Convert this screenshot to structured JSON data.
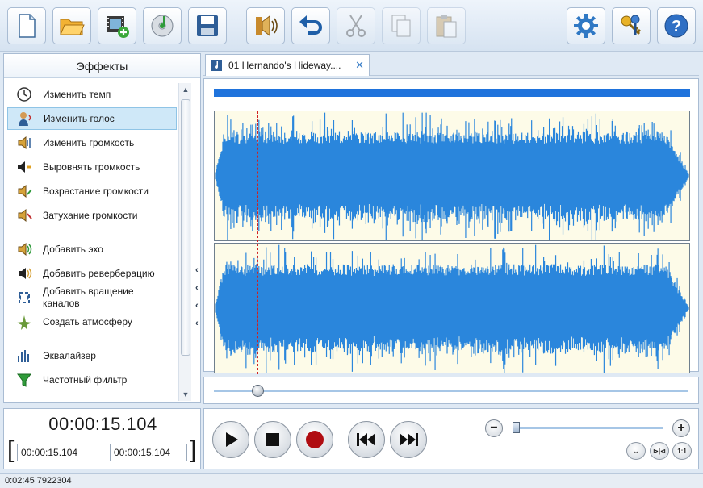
{
  "toolbar": {
    "buttons": [
      {
        "icon": "new-file-icon",
        "enabled": true
      },
      {
        "icon": "open-folder-icon",
        "enabled": true
      },
      {
        "icon": "import-video-icon",
        "enabled": true
      },
      {
        "icon": "cd-music-icon",
        "enabled": true
      },
      {
        "icon": "save-disk-icon",
        "enabled": true
      },
      {
        "icon": "audio-speaker-icon",
        "enabled": true
      },
      {
        "icon": "undo-icon",
        "enabled": true
      },
      {
        "icon": "cut-icon",
        "enabled": false
      },
      {
        "icon": "copy-icon",
        "enabled": false
      },
      {
        "icon": "paste-icon",
        "enabled": false
      },
      {
        "icon": "settings-gear-icon",
        "enabled": true
      },
      {
        "icon": "keys-icon",
        "enabled": true
      },
      {
        "icon": "help-icon",
        "enabled": true
      }
    ]
  },
  "effects": {
    "header": "Эффекты",
    "items": [
      {
        "label": "Изменить темп",
        "icon": "clock-icon",
        "selected": false
      },
      {
        "label": "Изменить голос",
        "icon": "voice-person-icon",
        "selected": true
      },
      {
        "label": "Изменить громкость",
        "icon": "volume-change-icon",
        "selected": false
      },
      {
        "label": "Выровнять громкость",
        "icon": "volume-normalize-icon",
        "selected": false
      },
      {
        "label": "Возрастание громкости",
        "icon": "volume-fade-in-icon",
        "selected": false
      },
      {
        "label": "Затухание громкости",
        "icon": "volume-fade-out-icon",
        "selected": false
      },
      {
        "label": "Добавить эхо",
        "icon": "echo-icon",
        "selected": false
      },
      {
        "label": "Добавить реверберацию",
        "icon": "reverb-icon",
        "selected": false
      },
      {
        "label": "Добавить вращение каналов",
        "icon": "channel-rotate-icon",
        "selected": false
      },
      {
        "label": "Создать атмосферу",
        "icon": "atmosphere-icon",
        "selected": false
      },
      {
        "label": "Эквалайзер",
        "icon": "equalizer-icon",
        "selected": false
      },
      {
        "label": "Частотный фильтр",
        "icon": "frequency-filter-icon",
        "selected": false
      }
    ]
  },
  "time": {
    "current": "00:00:15.104",
    "selection_start": "00:00:15.104",
    "selection_separator": "–",
    "selection_end": "00:00:15.104"
  },
  "tab": {
    "label": "01 Hernando's Hideway....",
    "close": "✕"
  },
  "waveform": {
    "color": "#2a86dc",
    "background": "#fdfbe8",
    "cursor_color": "#d02020",
    "cursor_fraction": 0.091,
    "channels": 2
  },
  "seek": {
    "position_fraction": 0.092
  },
  "transport": {
    "zoom_minus": "−",
    "zoom_plus": "+",
    "zoom_fraction": 0.01,
    "fit_label": "↔",
    "zoom_sel_label": "⊳|⊲",
    "one_to_one_label": "1:1"
  },
  "status": {
    "text": "0:02:45 7922304"
  }
}
